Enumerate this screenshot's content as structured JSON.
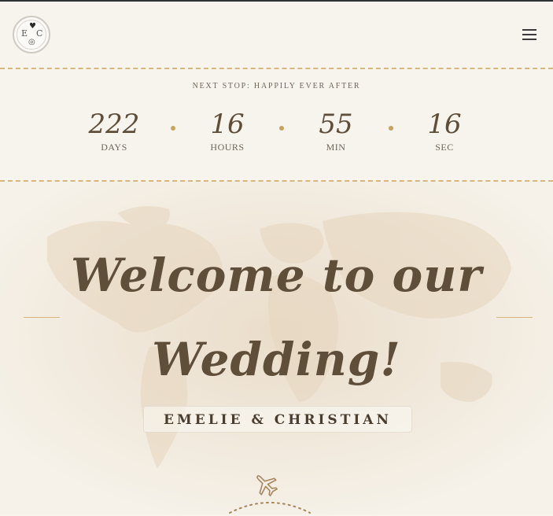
{
  "logo": {
    "initial_left": "E",
    "initial_right": "C"
  },
  "countdown": {
    "title": "NEXT STOP: HAPPILY EVER AFTER",
    "units": [
      {
        "value": "222",
        "label": "DAYS"
      },
      {
        "value": "16",
        "label": "HOURS"
      },
      {
        "value": "55",
        "label": "MIN"
      },
      {
        "value": "16",
        "label": "SEC"
      }
    ]
  },
  "hero": {
    "welcome_line1": "Welcome to our",
    "welcome_line2": "Wedding!",
    "names": "EMELIE & CHRISTIAN"
  },
  "colors": {
    "accent": "#c9a35b",
    "dashed": "#d8b67c",
    "text": "#5f4e3a",
    "background": "#f7f4ee"
  },
  "icons": {
    "menu": "hamburger-icon",
    "plane": "airplane-icon",
    "logo": "monogram-logo"
  }
}
